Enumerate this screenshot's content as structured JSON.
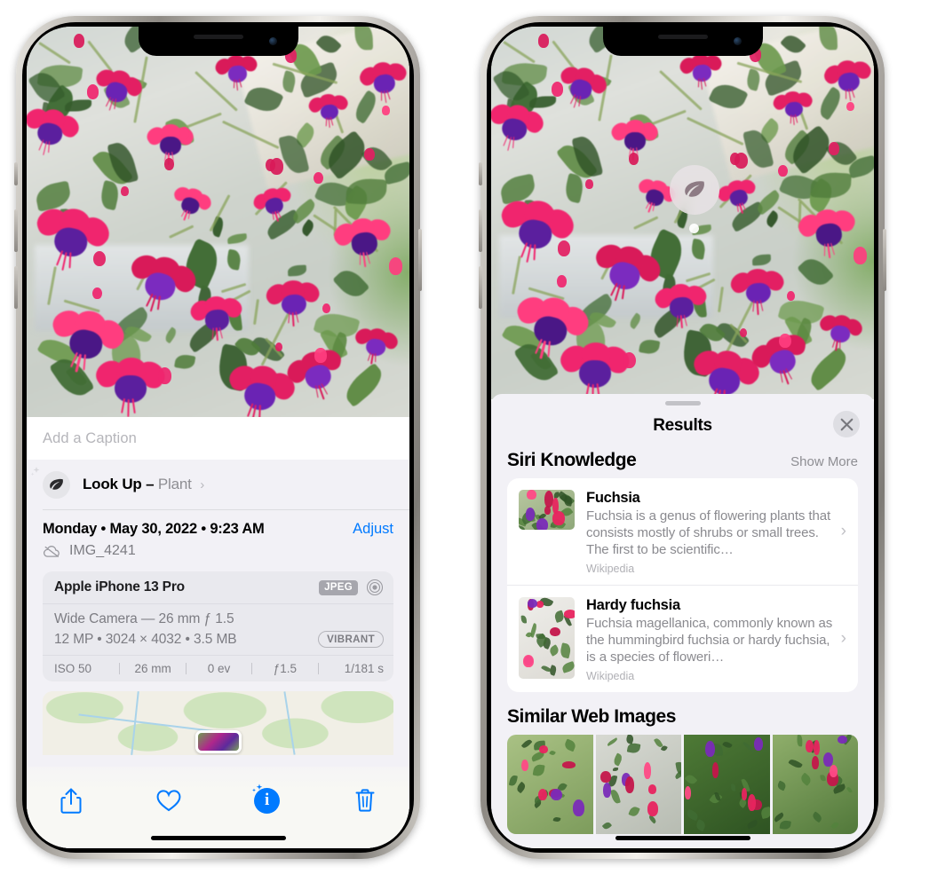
{
  "left_phone": {
    "photo": {
      "alt": "fuchsia-flowers-hanging-basket"
    },
    "caption_field": {
      "placeholder": "Add a Caption",
      "value": ""
    },
    "lookup": {
      "title": "Look Up",
      "dash": "–",
      "subject": "Plant",
      "chevron": "›",
      "icon": "leaf-icon"
    },
    "metadata": {
      "date": "Monday • May 30, 2022 • 9:23 AM",
      "adjust_label": "Adjust",
      "filename": "IMG_4241",
      "cloud_icon": "icloud-slash-icon"
    },
    "camera_card": {
      "model": "Apple iPhone 13 Pro",
      "format_badge": "JPEG",
      "lens_icon": "camera-lens-icon",
      "lens": "Wide Camera — 26 mm ƒ 1.5",
      "size": "12 MP • 3024 × 4032 • 3.5 MB",
      "style_badge": "VIBRANT",
      "exif": [
        "ISO 50",
        "26 mm",
        "0 ev",
        "ƒ1.5",
        "1/181 s"
      ]
    },
    "map": {
      "alt": "location-map-thumbnail"
    },
    "toolbar": [
      {
        "name": "share-button",
        "icon": "share-icon"
      },
      {
        "name": "favorite-button",
        "icon": "heart-icon"
      },
      {
        "name": "info-button",
        "icon": "info-sparkle-icon",
        "label": "i",
        "active": true
      },
      {
        "name": "delete-button",
        "icon": "trash-icon"
      }
    ]
  },
  "right_phone": {
    "visual_lookup_badge": {
      "icon": "leaf-icon"
    },
    "sheet": {
      "title": "Results",
      "close_icon": "close-icon",
      "siri_knowledge": {
        "heading": "Siri Knowledge",
        "show_more": "Show More",
        "items": [
          {
            "name": "Fuchsia",
            "description": "Fuchsia is a genus of flowering plants that consists mostly of shrubs or small trees. The first to be scientific…",
            "source": "Wikipedia",
            "thumb": "fuchsia-red-flowers-thumbnail"
          },
          {
            "name": "Hardy fuchsia",
            "description": "Fuchsia magellanica, commonly known as the hummingbird fuchsia or hardy fuchsia, is a species of floweri…",
            "source": "Wikipedia",
            "thumb": "hardy-fuchsia-specimen-thumbnail"
          }
        ]
      },
      "similar_web_images": {
        "heading": "Similar Web Images",
        "items": [
          "fuchsia-pink-purple-bloom",
          "fuchsia-red-closeup",
          "fuchsia-bush-garden",
          "fuchsia-purple-double-bloom"
        ]
      }
    }
  },
  "colors": {
    "accent_blue": "#007aff",
    "sheet_bg": "#f2f1f6",
    "card_bg": "#ffffff",
    "secondary_text": "#8e8e93"
  }
}
